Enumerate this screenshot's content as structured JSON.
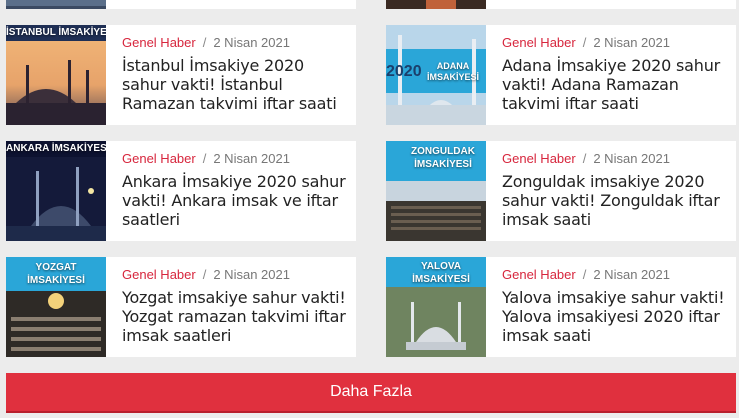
{
  "articles": [
    {
      "category": "Genel Haber",
      "date": "2 Nisan 2021",
      "title": "İstanbul İmsakiye 2020 sahur vakti! İstanbul Ramazan takvimi iftar saati",
      "thumb_text": "İSTANBUL İMSAKİYESİ"
    },
    {
      "category": "Genel Haber",
      "date": "2 Nisan 2021",
      "title": "Adana İmsakiye 2020 sahur vakti! Adana Ramazan takvimi iftar saati",
      "thumb_text": "ADANA İMSAKİYESİ",
      "thumb_year": "2020"
    },
    {
      "category": "Genel Haber",
      "date": "2 Nisan 2021",
      "title": "Ankara İmsakiye 2020 sahur vakti! Ankara imsak ve iftar saatleri",
      "thumb_text": "ANKARA İMSAKİYESİ"
    },
    {
      "category": "Genel Haber",
      "date": "2 Nisan 2021",
      "title": "Zonguldak imsakiye 2020 sahur vakti! Zonguldak iftar imsak saati",
      "thumb_text": "ZONGULDAK İMSAKİYESİ"
    },
    {
      "category": "Genel Haber",
      "date": "2 Nisan 2021",
      "title": "Yozgat imsakiye sahur vakti! Yozgat ramazan takvimi iftar imsak saatleri",
      "thumb_text": "YOZGAT İMSAKİYESİ"
    },
    {
      "category": "Genel Haber",
      "date": "2 Nisan 2021",
      "title": "Yalova imsakiye sahur vakti! Yalova imsakiyesi 2020 iftar imsak saati",
      "thumb_text": "YALOVA İMSAKİYESİ"
    }
  ],
  "separator": "/",
  "load_more_label": "Daha Fazla",
  "colors": {
    "category": "#d7263d",
    "button": "#e0303e",
    "background": "#ececec"
  }
}
